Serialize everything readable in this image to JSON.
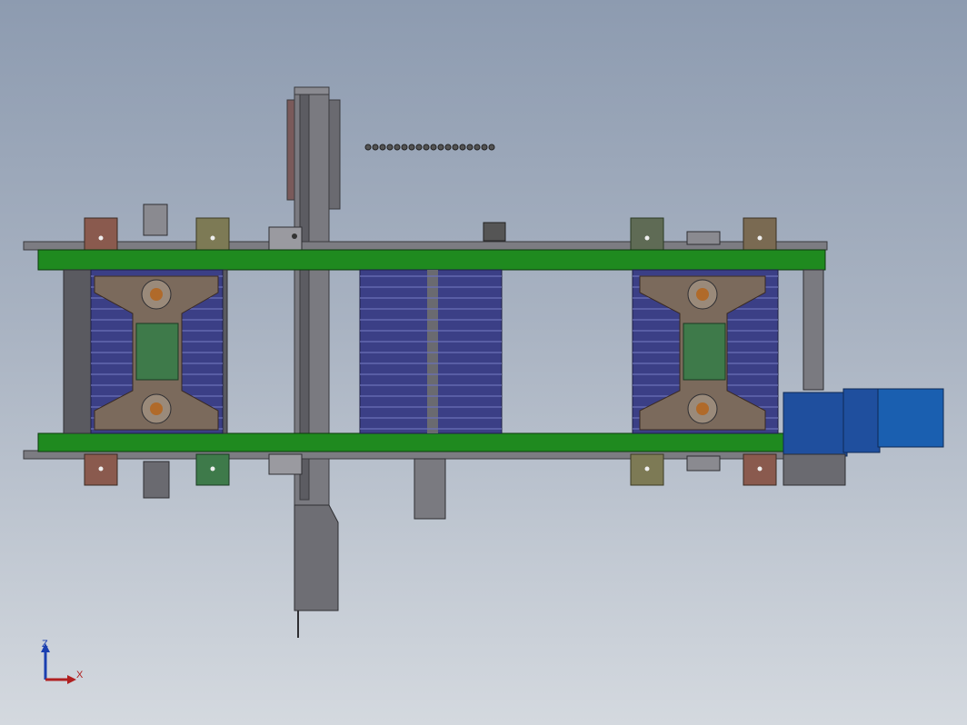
{
  "viewport": {
    "background_top": "#8d9bb0",
    "background_bottom": "#d4d9df"
  },
  "model": {
    "colors": {
      "frame_steel": "#6f6f74",
      "rail_green": "#1f8a1f",
      "roller_blue": "#3b3f86",
      "plate_brown": "#7b6a5c",
      "plate_green": "#3e7a4a",
      "motor_blue": "#1f4f9e",
      "bracket_rust": "#8a5a4e",
      "bracket_olive": "#7d7a55",
      "bearing_orange": "#b06a2a"
    }
  },
  "triad": {
    "z_label": "Z",
    "x_label": "X",
    "z_color": "#1a3fb0",
    "x_color": "#b02020"
  }
}
